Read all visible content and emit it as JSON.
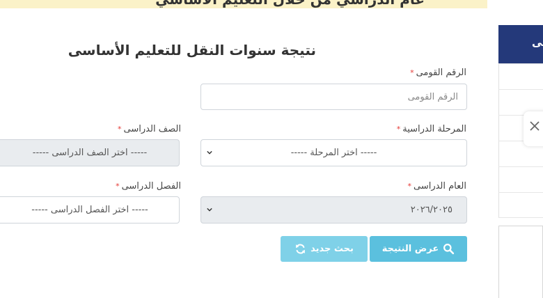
{
  "banner": {
    "text": "عام الدراسي من خلال التعليم الأساسي"
  },
  "form": {
    "title": "نتيجة سنوات النقل للتعليم الأساسى",
    "required_mark": "*",
    "national_id": {
      "label": "الرقم القومى",
      "placeholder": "الرقم القومى",
      "value": ""
    },
    "stage": {
      "label": "المرحلة الدراسية",
      "selected": "----- اختر المرحلة -----"
    },
    "grade": {
      "label": "الصف الدراسى",
      "selected": "----- اختر الصف الدراسى -----"
    },
    "year": {
      "label": "العام الدراسى",
      "selected": "٢٠٢٦/٢٠٢٥"
    },
    "term": {
      "label": "الفصل الدراسى",
      "selected": "----- اختر الفصل الدراسى -----"
    }
  },
  "buttons": {
    "show_result": "عرض النتيجة",
    "new_search": "بحث جديد"
  },
  "sidebar": {
    "header_text": "مى"
  },
  "icons": {
    "search": "search-icon",
    "refresh": "refresh-icon",
    "chevron": "chevron-down-icon",
    "close": "close-icon"
  },
  "colors": {
    "primary_button": "#5bc0de",
    "secondary_button": "#7fd1e8",
    "sidebar_header": "#24397a",
    "required": "#e53935",
    "banner": "#fbf2c8"
  }
}
